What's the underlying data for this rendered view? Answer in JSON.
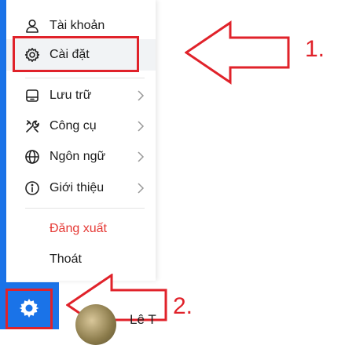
{
  "menu": {
    "items": [
      {
        "label": "Tài khoản",
        "icon": "user-icon",
        "chevron": false
      },
      {
        "label": "Cài đặt",
        "icon": "gear-icon",
        "chevron": false,
        "selected": true
      },
      {
        "label": "Lưu trữ",
        "icon": "storage-icon",
        "chevron": true
      },
      {
        "label": "Công cụ",
        "icon": "tools-icon",
        "chevron": true
      },
      {
        "label": "Ngôn ngữ",
        "icon": "globe-icon",
        "chevron": true
      },
      {
        "label": "Giới thiệu",
        "icon": "info-icon",
        "chevron": true
      }
    ],
    "logout_label": "Đăng xuất",
    "exit_label": "Thoát"
  },
  "annotations": {
    "step1": "1.",
    "step2": "2."
  },
  "user": {
    "name": "Lê T"
  },
  "colors": {
    "accent": "#1a73e8",
    "annotation": "#e0222a",
    "danger": "#e53935"
  }
}
